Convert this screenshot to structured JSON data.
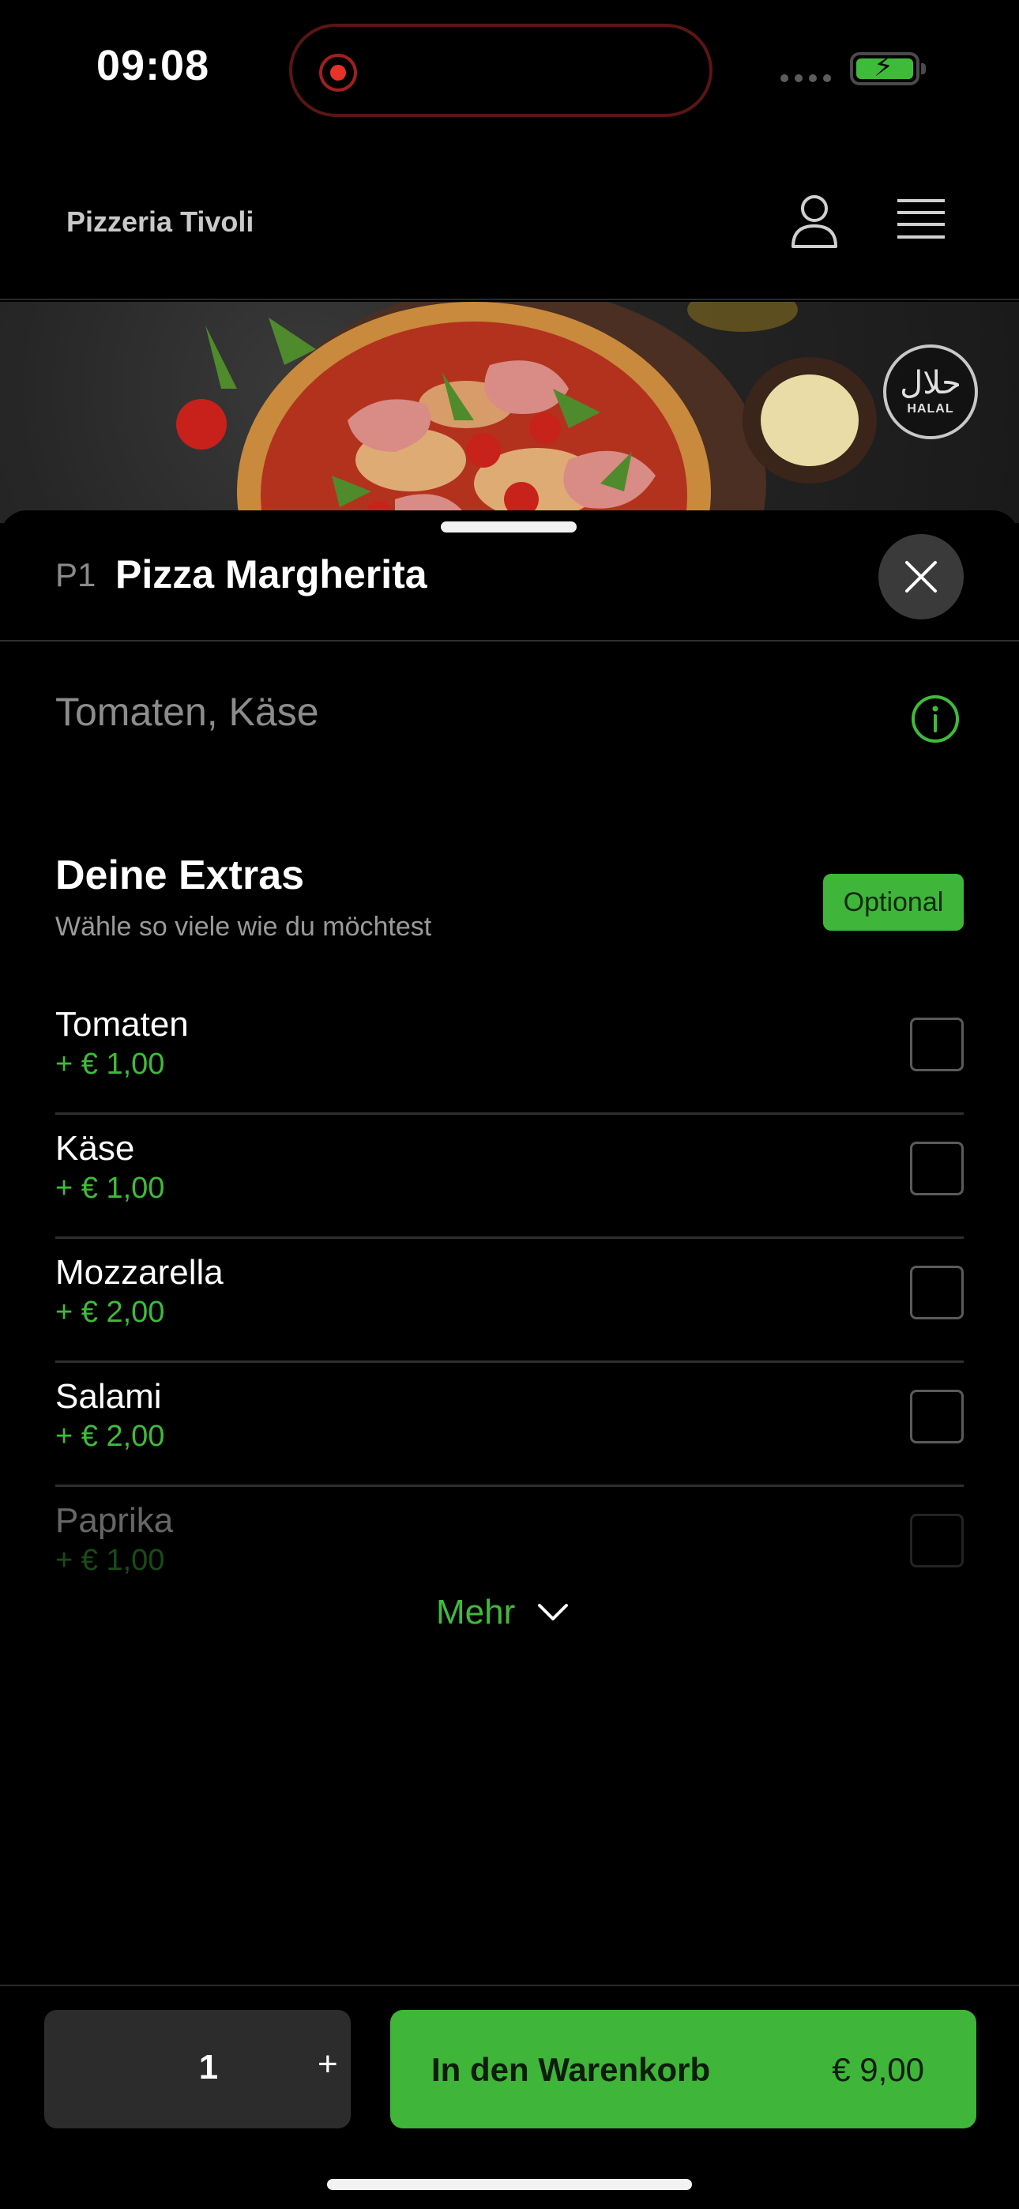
{
  "status_bar": {
    "time": "09:08",
    "colors": {
      "recording": "#e5332a",
      "battery": "#3fbb3a"
    }
  },
  "header": {
    "brand": "Pizzeria Tivoli",
    "icons": [
      "user-icon",
      "menu-icon"
    ]
  },
  "hero": {
    "badge_label": "HALAL",
    "badge_arabic": "حلال"
  },
  "product": {
    "code": "P1",
    "name": "Pizza Margherita",
    "description": "Tomaten, Käse"
  },
  "extras": {
    "title": "Deine Extras",
    "subtitle": "Wähle so viele wie du möchtest",
    "badge": "Optional",
    "items": [
      {
        "name": "Tomaten",
        "price": "+ € 1,00",
        "checked": false
      },
      {
        "name": "Käse",
        "price": "+ € 1,00",
        "checked": false
      },
      {
        "name": "Mozzarella",
        "price": "+ € 2,00",
        "checked": false
      },
      {
        "name": "Salami",
        "price": "+ € 2,00",
        "checked": false
      },
      {
        "name": "Paprika",
        "price": "+ € 1,00",
        "checked": false
      }
    ],
    "more_label": "Mehr"
  },
  "footer": {
    "quantity": "1",
    "plus_label": "+",
    "cart_label": "In den Warenkorb",
    "cart_price": "€ 9,00"
  },
  "theme": {
    "accent": "#3fb53a",
    "background": "#000000"
  }
}
